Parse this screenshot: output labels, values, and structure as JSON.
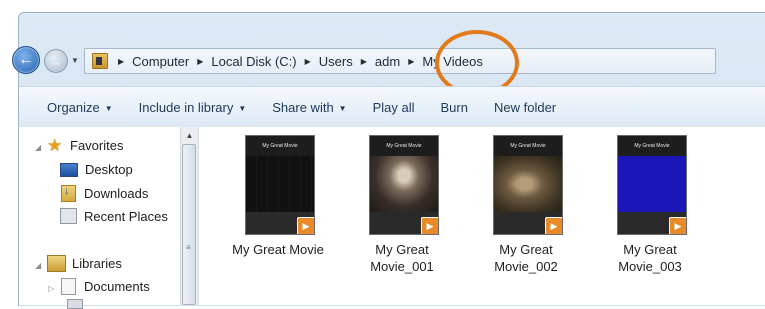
{
  "address_bar": {
    "breadcrumbs": [
      "Computer",
      "Local Disk (C:)",
      "Users",
      "adm",
      "My Videos"
    ]
  },
  "toolbar": {
    "buttons": [
      {
        "label": "Organize",
        "has_menu": true
      },
      {
        "label": "Include in library",
        "has_menu": true
      },
      {
        "label": "Share with",
        "has_menu": true
      },
      {
        "label": "Play all",
        "has_menu": false
      },
      {
        "label": "Burn",
        "has_menu": false
      },
      {
        "label": "New folder",
        "has_menu": false
      }
    ]
  },
  "nav_pane": {
    "favorites": {
      "label": "Favorites",
      "items": [
        "Desktop",
        "Downloads",
        "Recent Places"
      ]
    },
    "libraries": {
      "label": "Libraries",
      "items": [
        "Documents"
      ]
    }
  },
  "files": [
    {
      "name_line1": "My Great Movie",
      "name_line2": "",
      "thumb_title": "My Great Movie",
      "scene": "dark"
    },
    {
      "name_line1": "My Great",
      "name_line2": "Movie_001",
      "thumb_title": "My Great Movie",
      "scene": "stage"
    },
    {
      "name_line1": "My Great",
      "name_line2": "Movie_002",
      "thumb_title": "My Great Movie",
      "scene": "soldiers"
    },
    {
      "name_line1": "My Great",
      "name_line2": "Movie_003",
      "thumb_title": "My Great Movie",
      "scene": "blue"
    }
  ],
  "colors": {
    "highlight_ring": "#e27a1c",
    "toolbar_text": "#1e395b",
    "play_badge": "#e98a2a"
  }
}
